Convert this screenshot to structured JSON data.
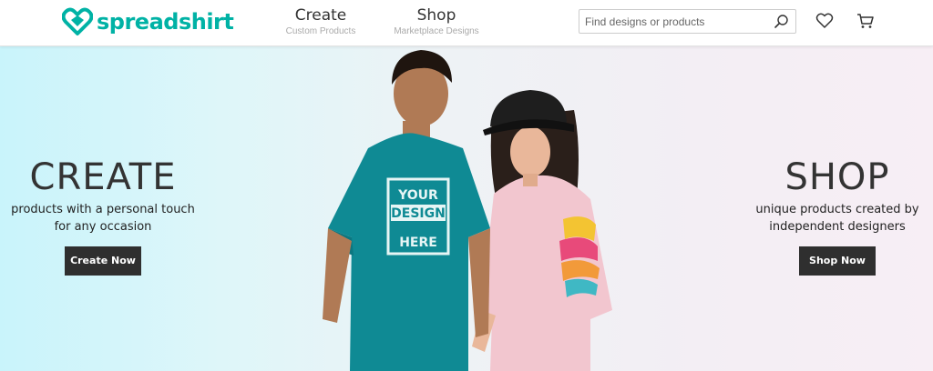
{
  "header": {
    "logo_text": "spreadshirt",
    "nav": [
      {
        "title": "Create",
        "subtitle": "Custom Products"
      },
      {
        "title": "Shop",
        "subtitle": "Marketplace Designs"
      }
    ],
    "search": {
      "placeholder": "Find designs or products",
      "value": ""
    },
    "icons": [
      "search-icon",
      "heart-icon",
      "cart-icon"
    ]
  },
  "hero": {
    "create": {
      "title": "CREATE",
      "subtitle_line1": "products with a personal touch",
      "subtitle_line2": "for any occasion",
      "button": "Create Now"
    },
    "shop": {
      "title": "SHOP",
      "subtitle_line1": "unique products created by",
      "subtitle_line2": "independent designers",
      "button": "Shop Now"
    },
    "tshirt_print": [
      "YOUR",
      "DESIGN",
      "HERE"
    ]
  },
  "colors": {
    "brand": "#00b2a5",
    "button_bg": "#2f2f2f",
    "teal_shirt": "#0f8a94",
    "pink_shirt": "#f2c6cf"
  }
}
